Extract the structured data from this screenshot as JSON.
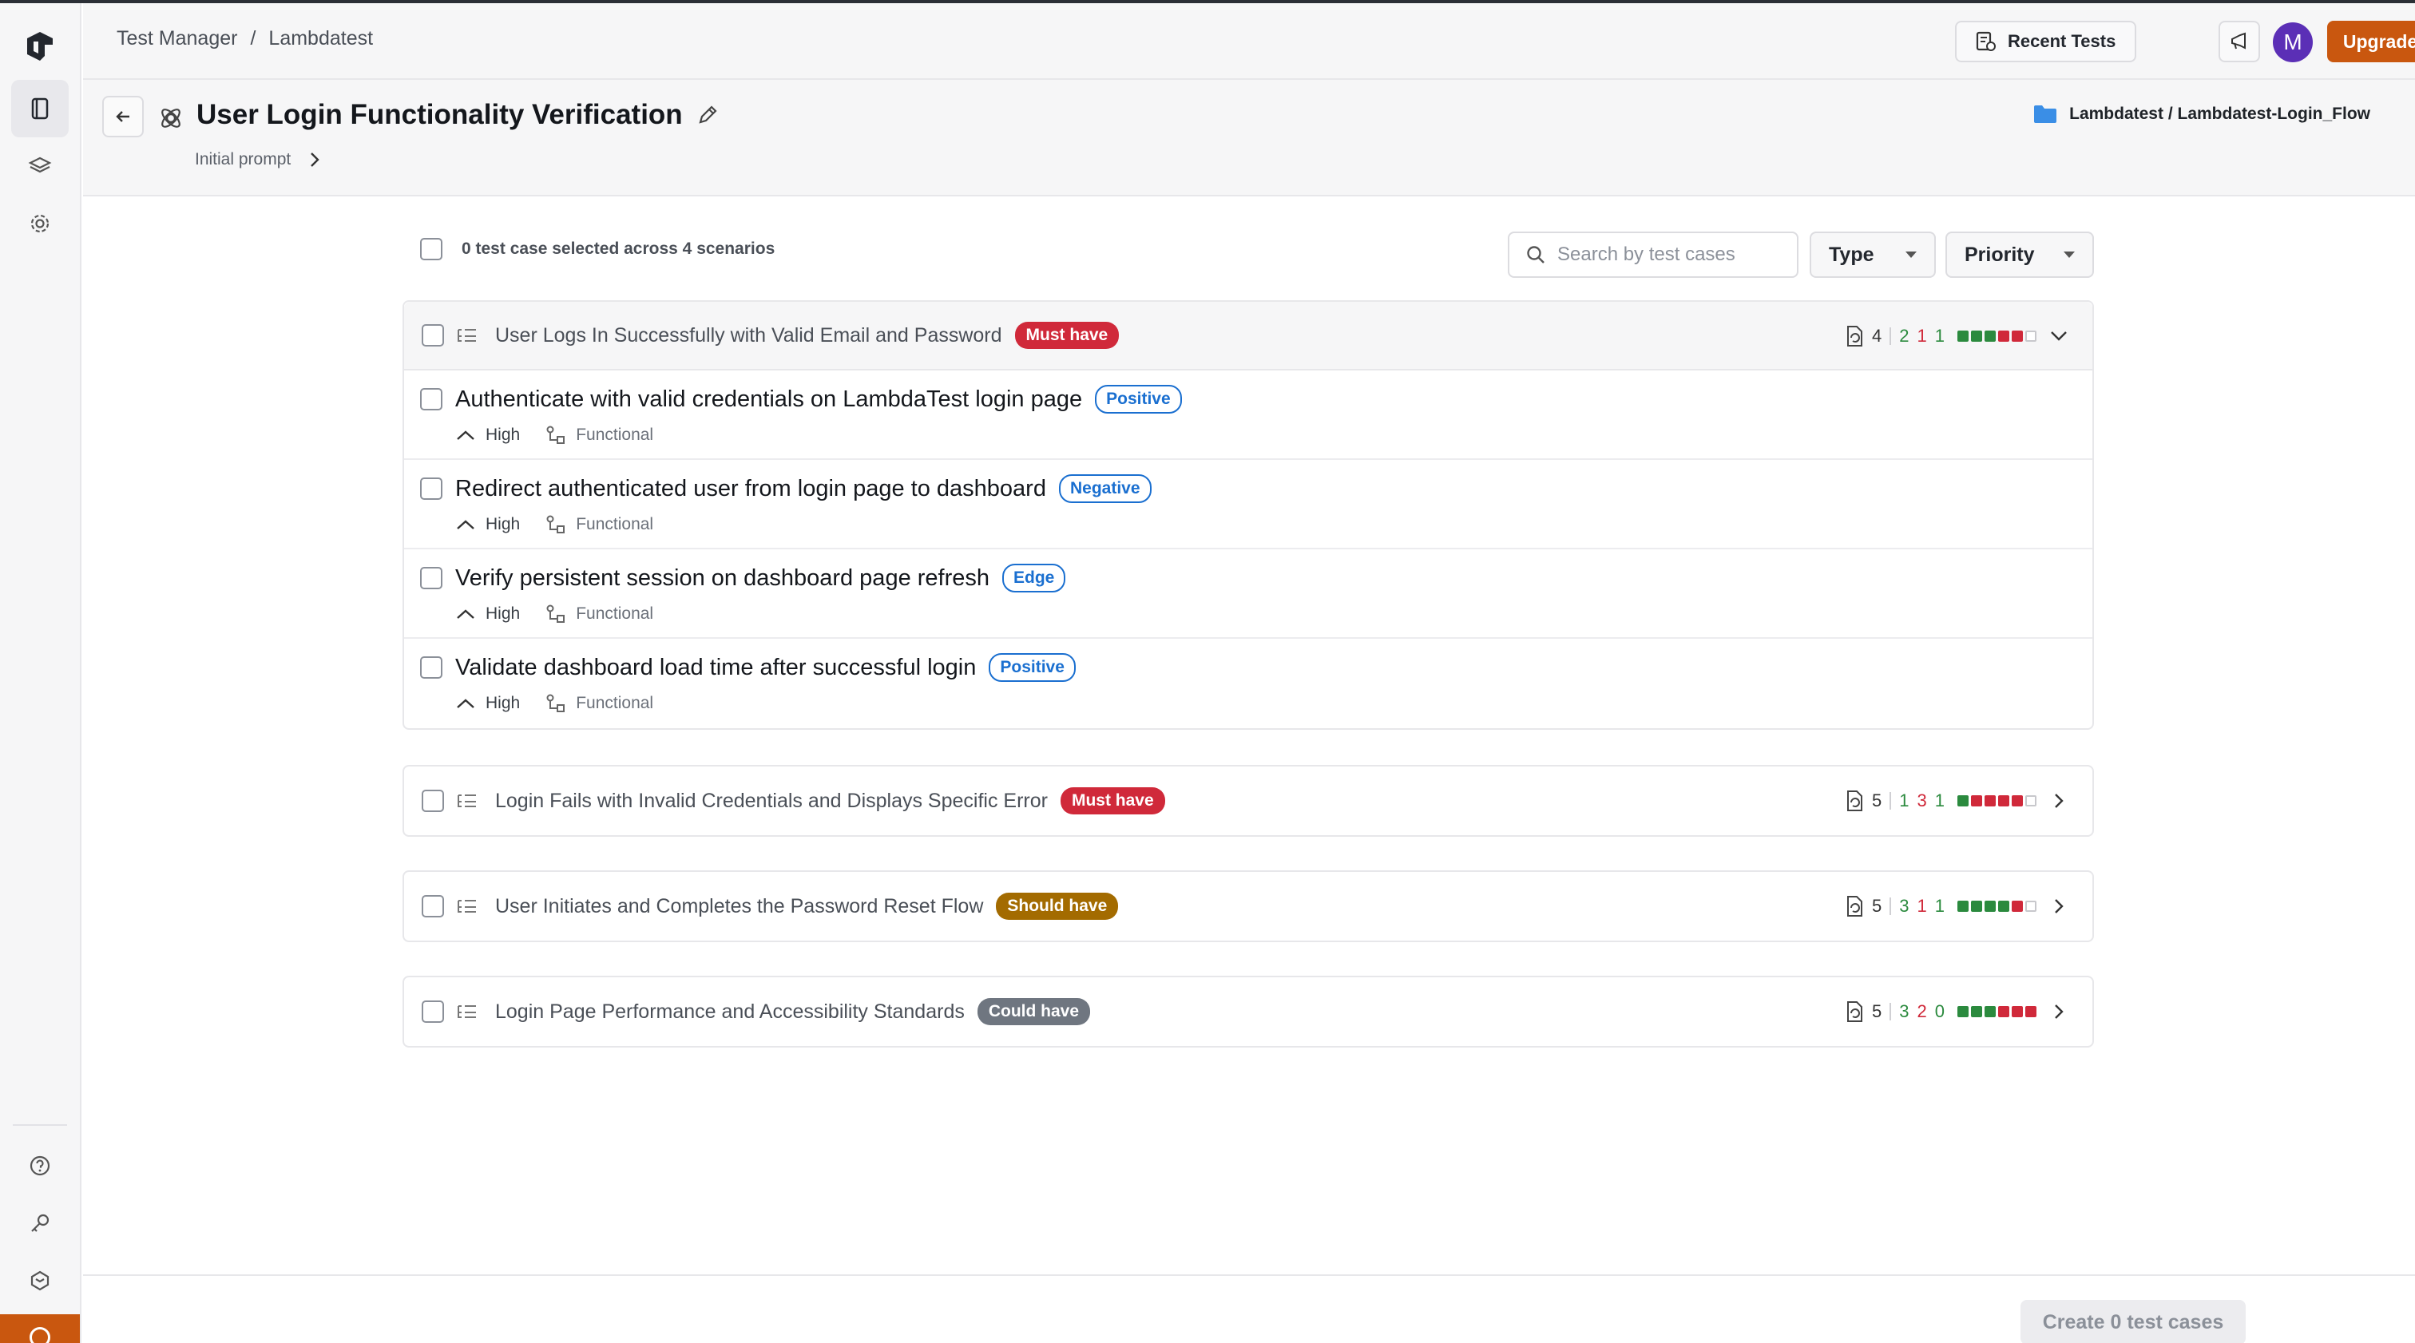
{
  "header": {
    "breadcrumb": [
      "Test Manager",
      "Lambdatest"
    ],
    "breadcrumb_sep": "/",
    "recent_tests_label": "Recent Tests",
    "avatar_initial": "M",
    "upgrade_label": "Upgrade Now"
  },
  "page": {
    "title": "User Login Functionality Verification",
    "subnav_label": "Initial prompt",
    "folder_path": "Lambdatest / Lambdatest-Login_Flow"
  },
  "toolbar": {
    "selection_summary": "0 test case selected across 4 scenarios",
    "search_placeholder": "Search by test cases",
    "type_filter": "Type",
    "priority_filter": "Priority"
  },
  "scenarios": [
    {
      "title": "User Logs In Successfully with Valid Email and Password",
      "badge": "Must have",
      "count": "4",
      "counts": [
        "2",
        "1",
        "1"
      ],
      "bars": [
        "g",
        "g",
        "g",
        "r",
        "r",
        "e"
      ],
      "expanded": true,
      "cases": [
        {
          "title": "Authenticate with valid credentials on LambdaTest login page",
          "tag": "Positive",
          "priority": "High",
          "type": "Functional"
        },
        {
          "title": "Redirect authenticated user from login page to dashboard",
          "tag": "Negative",
          "priority": "High",
          "type": "Functional"
        },
        {
          "title": "Verify persistent session on dashboard page refresh",
          "tag": "Edge",
          "priority": "High",
          "type": "Functional"
        },
        {
          "title": "Validate dashboard load time after successful login",
          "tag": "Positive",
          "priority": "High",
          "type": "Functional"
        }
      ]
    },
    {
      "title": "Login Fails with Invalid Credentials and Displays Specific Error",
      "badge": "Must have",
      "count": "5",
      "counts": [
        "1",
        "3",
        "1"
      ],
      "bars": [
        "g",
        "r",
        "r",
        "r",
        "r",
        "e"
      ],
      "expanded": false
    },
    {
      "title": "User Initiates and Completes the Password Reset Flow",
      "badge": "Should have",
      "count": "5",
      "counts": [
        "3",
        "1",
        "1"
      ],
      "bars": [
        "g",
        "g",
        "g",
        "g",
        "r",
        "e"
      ],
      "expanded": false
    },
    {
      "title": "Login Page Performance and Accessibility Standards",
      "badge": "Could have",
      "count": "5",
      "counts": [
        "3",
        "2",
        "0"
      ],
      "bars": [
        "g",
        "g",
        "g",
        "r",
        "r",
        "r"
      ],
      "expanded": false
    }
  ],
  "footer": {
    "create_label": "Create 0 test cases"
  },
  "colors": {
    "accent": "#c9570f",
    "must_have": "#d0293a",
    "should_have": "#a36b00",
    "could_have": "#6f7680",
    "tag_blue": "#1a6fd0",
    "pass_green": "#2b8a3e"
  },
  "icons": [
    "logo-icon",
    "test-manager-icon",
    "layers-icon",
    "settings-icon",
    "help-icon",
    "key-icon",
    "integrations-icon",
    "recent-tests-icon",
    "announcement-icon",
    "back-arrow-icon",
    "ai-generate-icon",
    "edit-pencil-icon",
    "chevron-right-icon",
    "folder-icon",
    "search-icon",
    "scenario-list-icon",
    "priority-high-icon",
    "functional-type-icon",
    "test-count-icon",
    "chevron-down-icon"
  ]
}
